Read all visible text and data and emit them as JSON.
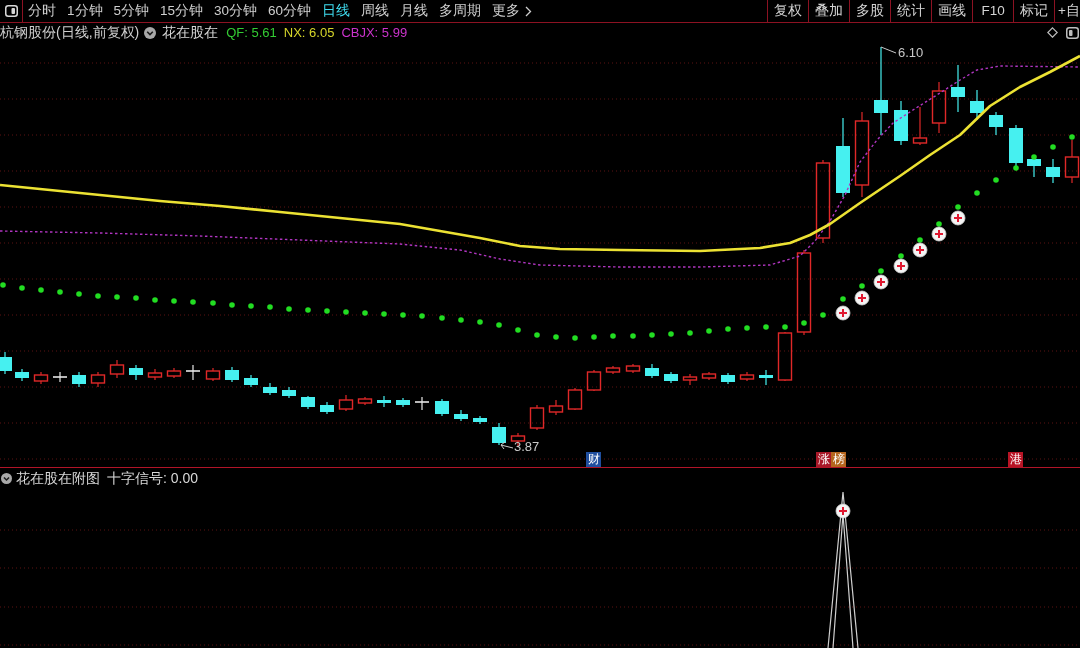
{
  "toolbar": {
    "periods": [
      {
        "label": "分时",
        "selected": false
      },
      {
        "label": "1分钟",
        "selected": false
      },
      {
        "label": "5分钟",
        "selected": false
      },
      {
        "label": "15分钟",
        "selected": false
      },
      {
        "label": "30分钟",
        "selected": false
      },
      {
        "label": "60分钟",
        "selected": false
      },
      {
        "label": "日线",
        "selected": true
      },
      {
        "label": "周线",
        "selected": false
      },
      {
        "label": "月线",
        "selected": false
      },
      {
        "label": "多周期",
        "selected": false
      }
    ],
    "more": "更多",
    "tools": [
      "复权",
      "叠加",
      "多股",
      "统计",
      "画线",
      "F10",
      "标记",
      "+自"
    ]
  },
  "main_chart": {
    "title": "杭钢股份(日线,前复权)",
    "indicator": "花在股在",
    "values": [
      {
        "label": "QF: 5.61",
        "color": "#33cc33"
      },
      {
        "label": "NX: 6.05",
        "color": "#d6d62a"
      },
      {
        "label": "CBJX: 5.99",
        "color": "#cc33cc"
      }
    ],
    "annotations": [
      {
        "kind": "high",
        "text": "6.10"
      },
      {
        "kind": "low",
        "text": "3.87"
      }
    ],
    "event_markers": [
      {
        "label": "财",
        "color": "#1f4e9e"
      },
      {
        "label": "涨",
        "color": "#a81828"
      },
      {
        "label": "榜",
        "color": "#b5651d"
      },
      {
        "label": "港",
        "color": "#b81425"
      }
    ]
  },
  "sub_chart": {
    "indicator": "花在股在附图",
    "readout": "十字信号: 0.00"
  }
}
